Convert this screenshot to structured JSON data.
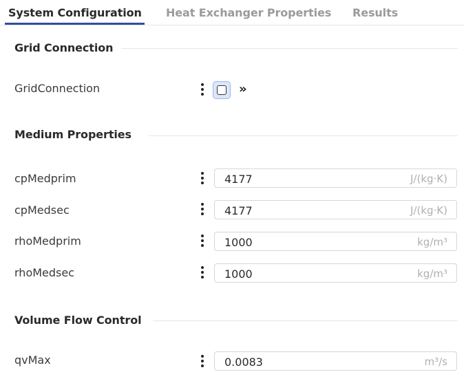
{
  "tabs": [
    {
      "label": "System Configuration",
      "active": true
    },
    {
      "label": "Heat Exchanger Properties",
      "active": false
    },
    {
      "label": "Results",
      "active": false
    }
  ],
  "sections": {
    "grid": {
      "title": "Grid Connection",
      "params": {
        "grid_connection": {
          "label": "GridConnection",
          "checked": false
        }
      }
    },
    "medium": {
      "title": "Medium Properties",
      "params": [
        {
          "label": "cpMedprim",
          "value": "4177",
          "unit": "J/(kg·K)"
        },
        {
          "label": "cpMedsec",
          "value": "4177",
          "unit": "J/(kg·K)"
        },
        {
          "label": "rhoMedprim",
          "value": "1000",
          "unit": "kg/m³"
        },
        {
          "label": "rhoMedsec",
          "value": "1000",
          "unit": "kg/m³"
        }
      ]
    },
    "flow": {
      "title": "Volume Flow Control",
      "params": [
        {
          "label": "qvMax",
          "value": "0.0083",
          "unit": "m³/s"
        }
      ]
    }
  },
  "icons": {
    "more": "kebab-menu-icon",
    "expand": "double-chevron-right-icon"
  },
  "colors": {
    "accent": "#2f4ea3",
    "checkbox_focus_bg": "#dce6fb"
  }
}
